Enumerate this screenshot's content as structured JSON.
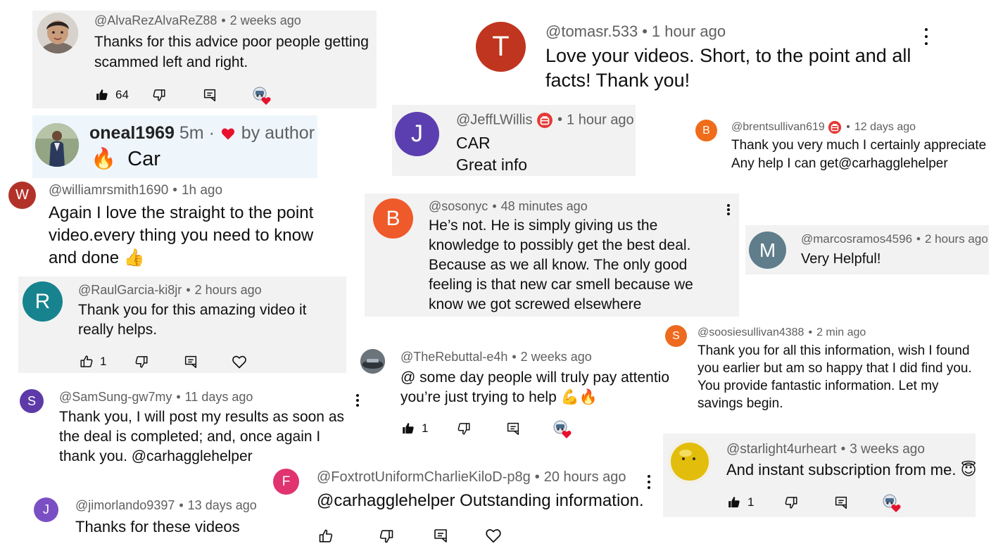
{
  "comments": {
    "alvarez": {
      "handle": "@AlvaRezAlvaReZ88",
      "time": "2 weeks ago",
      "text": "Thanks for this advice poor people getting scammed left and right.",
      "likes": "64"
    },
    "oneal": {
      "name": "oneal1969",
      "time": "5m",
      "by": "by author",
      "emoji": "🔥",
      "text": "Car"
    },
    "williams": {
      "initial": "W",
      "handle": "@williamrsmith1690",
      "time": "1h ago",
      "text": "Again I love the straight to the point video.every thing you need to know and done",
      "emoji": "👍"
    },
    "raul": {
      "initial": "R",
      "handle": "@RaulGarcia-ki8jr",
      "time": "2 hours ago",
      "text": "Thank you for this amazing video it really helps.",
      "likes": "1"
    },
    "samsung": {
      "initial": "S",
      "handle": "@SamSung-gw7my",
      "time": "11 days ago",
      "text": "Thank you, I will post my results as soon as the deal is completed; and, once again I thank you. @carhagglehelper"
    },
    "jimorlando": {
      "initial": "J",
      "handle": "@jimorlando9397",
      "time": "13 days ago",
      "text": "Thanks for these videos"
    },
    "tomasr": {
      "initial": "T",
      "handle": "@tomasr.533",
      "time": "1 hour ago",
      "text": "Love your videos. Short, to the point and all facts!  Thank you!"
    },
    "jeff": {
      "initial": "J",
      "handle": "@JeffLWillis",
      "time": "1 hour ago",
      "line1": "CAR",
      "line2": "Great info"
    },
    "brent": {
      "initial": "B",
      "handle": "@brentsullivan619",
      "time": "12 days ago",
      "line1": "Thank you very much I certainly appreciate",
      "line2": "Any help I can get@carhagglehelper"
    },
    "sosonyc": {
      "initial": "B",
      "handle": "@sosonyc",
      "time": "48 minutes ago",
      "text": "He’s not. He is simply giving us the knowledge to possibly get the best deal. Because as we all know. The only good feeling is that new car smell because we know we got screwed elsewhere"
    },
    "marcos": {
      "initial": "M",
      "handle": "@marcosramos4596",
      "time": "2 hours ago",
      "text": "Very Helpful!"
    },
    "rebuttal": {
      "handle": "@TheRebuttal-e4h",
      "time": "2 weeks ago",
      "line1": "@ some day people will truly pay attentio",
      "line2": "you’re just trying to help",
      "emoji": "💪🔥",
      "likes": "1"
    },
    "soosie": {
      "initial": "S",
      "handle": "@soosiesullivan4388",
      "time": "2 min ago",
      "text": "Thank you for all this information, wish I found you earlier but am so happy that I did find you. You provide fantastic information. Let my savings begin."
    },
    "foxtrot": {
      "initial": "F",
      "handle": "@FoxtrotUniformCharlieKiloD-p8g",
      "time": "20 hours ago",
      "text": "@carhagglehelper Outstanding information."
    },
    "starlight": {
      "handle": "@starlight4urheart",
      "time": "3 weeks ago",
      "text": "And instant subscription from me.",
      "emoji": "😇",
      "likes": "1"
    }
  },
  "colors": {
    "avatar_w": "#b2322a",
    "avatar_r": "#17838f",
    "avatar_s_purple": "#5e3aa8",
    "avatar_j": "#7b4fc4",
    "avatar_t": "#c0351f",
    "avatar_jeff": "#5b3fb0",
    "avatar_b_orange": "#ef6c1a",
    "avatar_b_red": "#ef5a2b",
    "avatar_m": "#5f7d8a",
    "avatar_s_orange": "#ee6a1f",
    "avatar_f": "#e0336f",
    "heart": "#e8112d",
    "badge": "#e53935"
  }
}
